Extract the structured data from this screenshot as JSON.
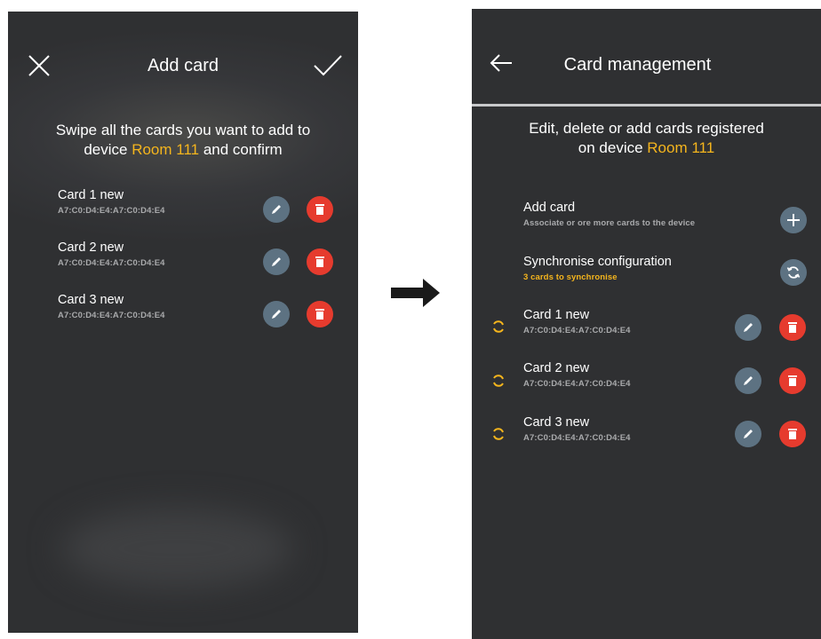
{
  "left_screen": {
    "title": "Add card",
    "instruction_before": "Swipe all the cards you want to add to",
    "instruction_device_prefix": "device ",
    "device_name": "Room 111",
    "instruction_after": " and confirm",
    "cards": [
      {
        "name": "Card 1 new",
        "id": "A7:C0:D4:E4:A7:C0:D4:E4"
      },
      {
        "name": "Card 2 new",
        "id": "A7:C0:D4:E4:A7:C0:D4:E4"
      },
      {
        "name": "Card 3 new",
        "id": "A7:C0:D4:E4:A7:C0:D4:E4"
      }
    ]
  },
  "right_screen": {
    "title": "Card management",
    "instruction_line1": "Edit, delete or add cards registered",
    "instruction_device_prefix": "on device ",
    "device_name": "Room 111",
    "add_card": {
      "label": "Add card",
      "sub": "Associate or ore more cards to the device"
    },
    "sync": {
      "label": "Synchronise configuration",
      "sub": "3 cards to synchronise"
    },
    "cards": [
      {
        "name": "Card 1 new",
        "id": "A7:C0:D4:E4:A7:C0:D4:E4"
      },
      {
        "name": "Card 2 new",
        "id": "A7:C0:D4:E4:A7:C0:D4:E4"
      },
      {
        "name": "Card 3 new",
        "id": "A7:C0:D4:E4:A7:C0:D4:E4"
      }
    ]
  },
  "colors": {
    "background": "#2f3032",
    "highlight": "#f5b51d",
    "edit_button": "#5d7282",
    "delete_button": "#e63b2e"
  },
  "icons": [
    "close-icon",
    "check-icon",
    "back-arrow-icon",
    "pencil-icon",
    "trash-icon",
    "plus-icon",
    "sync-icon",
    "pending-sync-icon",
    "transition-arrow-icon"
  ]
}
